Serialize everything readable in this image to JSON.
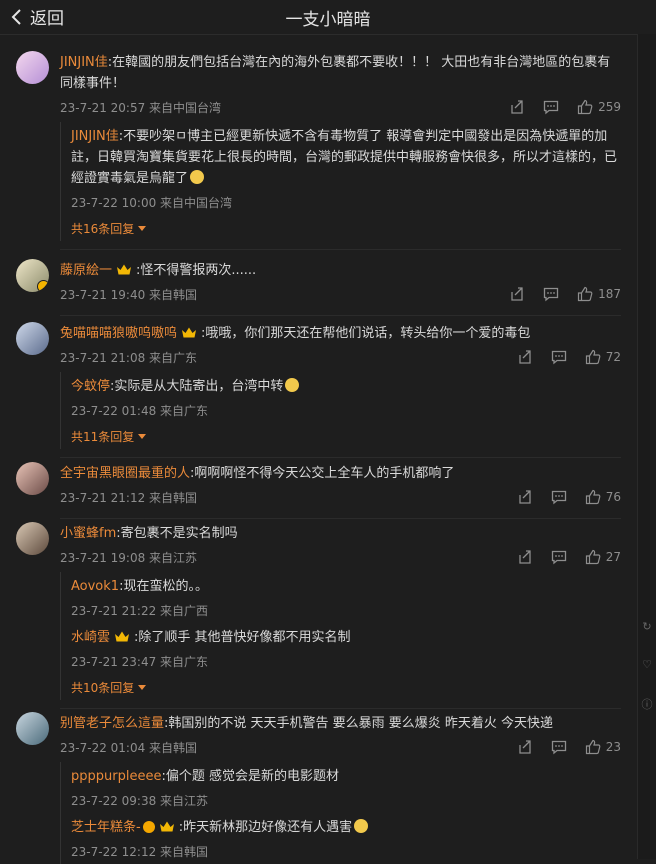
{
  "header": {
    "back_label": "返回",
    "title": "一支小暗暗"
  },
  "comments": [
    {
      "name": "JINJIN佳",
      "text": ":在韓國的朋友們包括台灣在內的海外包裹都不要收！！！ 大田也有非台灣地區的包裹有同樣事件！",
      "meta": "23-7-21 20:57 来自中国台湾",
      "likes": "259",
      "replies": [
        {
          "name": "JINJIN佳",
          "text": ":不要吵架ㅁ博主已經更新快遞不含有毒物質了 報導會判定中國發出是因為快遞單的加註，日韓買淘寶集貨要花上很長的時間，台灣的郵政提供中轉服務會快很多，所以才這樣的，已經證實毒氣是烏龍了",
          "meta": "23-7-22 10:00 来自中国台湾"
        }
      ],
      "more": "共16条回复"
    },
    {
      "name": "藤原絵一",
      "text": ":怪不得警报两次......",
      "meta": "23-7-21 19:40 来自韩国",
      "likes": "187"
    },
    {
      "name": "兔喵喵喵狼嗷呜嗷呜",
      "text": ":哦哦，你们那天还在帮他们说话，转头给你一个爱的毒包",
      "meta": "23-7-21 21:08 来自广东",
      "likes": "72",
      "replies": [
        {
          "name": "今蚊停",
          "text": ":实际是从大陆寄出，台湾中转",
          "meta": "23-7-22 01:48 来自广东"
        }
      ],
      "more": "共11条回复"
    },
    {
      "name": "全宇宙黑眼圈最重的人",
      "text": ":啊啊啊怪不得今天公交上全车人的手机都响了",
      "meta": "23-7-21 21:12 来自韩国",
      "likes": "76"
    },
    {
      "name": "小蜜蜂fm",
      "text": ":寄包裹不是实名制吗",
      "meta": "23-7-21 19:08 来自江苏",
      "likes": "27",
      "replies": [
        {
          "name": "Aovok1",
          "text": ":现在蛮松的。。",
          "meta": "23-7-21 21:22 来自广西"
        },
        {
          "name": "水崎雲",
          "text": ":除了顺手 其他普快好像都不用实名制",
          "meta": "23-7-21 23:47 来自广东"
        }
      ],
      "more": "共10条回复"
    },
    {
      "name": "别管老子怎么這量",
      "text": ":韩国别的不说 天天手机警告 要么暴雨 要么爆炎 昨天着火 今天快递",
      "meta": "23-7-22 01:04 来自韩国",
      "likes": "23",
      "replies": [
        {
          "name": "ppppurpleeee",
          "text": ":偏个题 感觉会是新的电影题材",
          "meta": "23-7-22 09:38 来自江苏"
        },
        {
          "name": "芝士年糕条-",
          "text": ":昨天新林那边好像还有人遇害",
          "meta": "23-7-22 12:12 来自韩国"
        }
      ]
    }
  ],
  "colors": {
    "background": "#1e1e1e",
    "name": "#ea8a3a",
    "meta": "#8e8e8e"
  },
  "icons": [
    "back-icon",
    "share-icon",
    "reply-icon",
    "like-icon"
  ]
}
